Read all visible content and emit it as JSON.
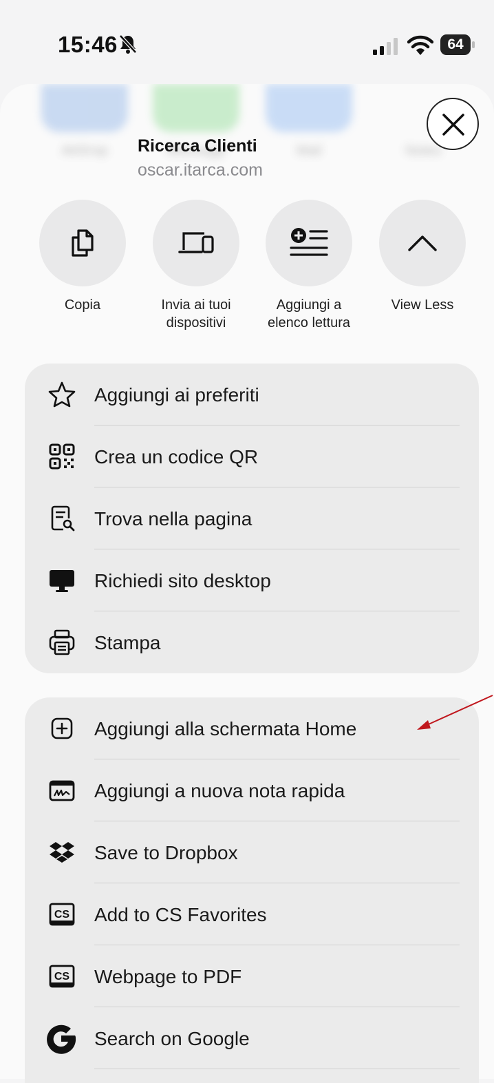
{
  "status_bar": {
    "time": "15:46",
    "battery": "64"
  },
  "ghost_share_row": [
    "AirDrop",
    "Messaggi",
    "Mail",
    "Notes"
  ],
  "header": {
    "title": "Ricerca Clienti",
    "url": "oscar.itarca.com"
  },
  "actions": [
    {
      "label": "Copia",
      "icon": "copy-icon"
    },
    {
      "label": "Invia ai tuoi dispositivi",
      "icon": "devices-icon"
    },
    {
      "label": "Aggiungi a elenco lettura",
      "icon": "reading-list-icon"
    },
    {
      "label": "View Less",
      "icon": "chevron-up-icon"
    }
  ],
  "group1": [
    {
      "label": "Aggiungi ai preferiti",
      "icon": "star-icon"
    },
    {
      "label": "Crea un codice QR",
      "icon": "qr-code-icon"
    },
    {
      "label": "Trova nella pagina",
      "icon": "find-in-page-icon"
    },
    {
      "label": "Richiedi sito desktop",
      "icon": "desktop-icon"
    },
    {
      "label": "Stampa",
      "icon": "printer-icon"
    }
  ],
  "group2": [
    {
      "label": "Aggiungi alla schermata Home",
      "icon": "add-square-icon"
    },
    {
      "label": "Aggiungi a nuova nota rapida",
      "icon": "quick-note-icon"
    },
    {
      "label": "Save to Dropbox",
      "icon": "dropbox-icon"
    },
    {
      "label": "Add to CS Favorites",
      "icon": "cs-icon"
    },
    {
      "label": "Webpage to PDF",
      "icon": "cs-icon"
    },
    {
      "label": "Search on Google",
      "icon": "google-icon"
    }
  ],
  "colors": {
    "annotation_arrow": "#c0171d",
    "group_bg": "#ebebeb",
    "sheet_bg": "#fafafa"
  }
}
